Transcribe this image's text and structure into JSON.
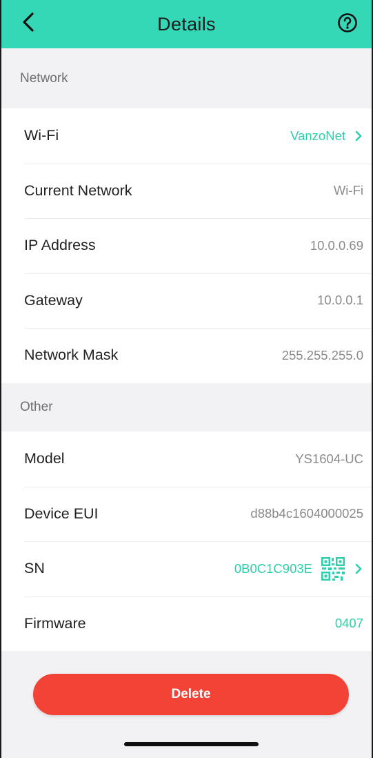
{
  "header": {
    "title": "Details",
    "back_icon": "chevron-left-icon",
    "help_icon": "question-circle-icon"
  },
  "network_section": {
    "title": "Network",
    "rows": [
      {
        "label": "Wi-Fi",
        "value": "VanzoNet",
        "accent": true,
        "chevron": true
      },
      {
        "label": "Current Network",
        "value": "Wi-Fi"
      },
      {
        "label": "IP Address",
        "value": "10.0.0.69"
      },
      {
        "label": "Gateway",
        "value": "10.0.0.1"
      },
      {
        "label": "Network Mask",
        "value": "255.255.255.0"
      }
    ]
  },
  "other_section": {
    "title": "Other",
    "rows": [
      {
        "label": "Model",
        "value": "YS1604-UC"
      },
      {
        "label": "Device EUI",
        "value": "d88b4c1604000025"
      },
      {
        "label": "SN",
        "value": "0B0C1C903E",
        "accent": true,
        "qr_icon": "qr-code-icon",
        "chevron": true
      },
      {
        "label": "Firmware",
        "value": "0407",
        "accent": true
      }
    ]
  },
  "actions": {
    "delete_label": "Delete"
  },
  "colors": {
    "header_bg": "#34d7b6",
    "accent": "#2dcfaa",
    "delete_bg": "#f34337",
    "page_bg": "#f2f2f4"
  }
}
